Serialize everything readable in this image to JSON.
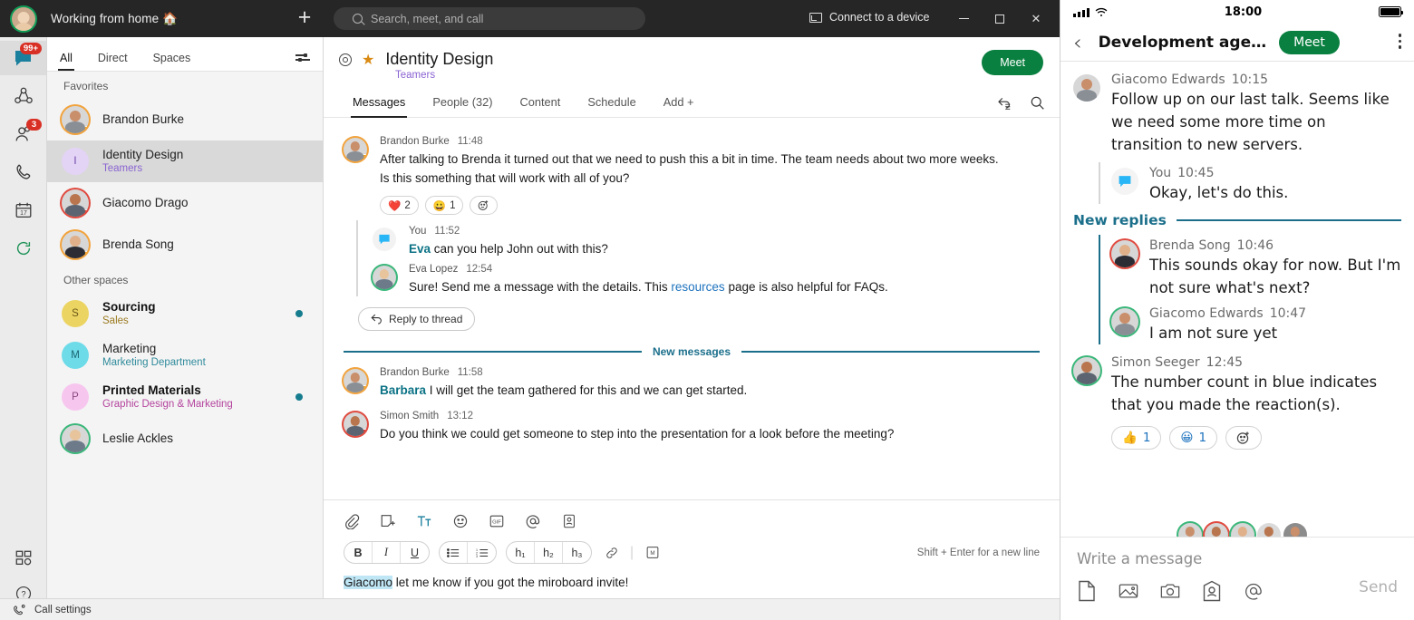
{
  "desktop": {
    "titlebar": {
      "status_text": "Working from home 🏠",
      "plus_icon": "plus-icon",
      "search_placeholder": "Search, meet, and call",
      "connect_label": "Connect to a device",
      "minimize": "−",
      "maximize": "▢",
      "close": "✕"
    },
    "rail": {
      "items": [
        {
          "name": "messages",
          "badge": "99+"
        },
        {
          "name": "spaces",
          "badge": ""
        },
        {
          "name": "contacts",
          "badge": "3"
        },
        {
          "name": "calls",
          "badge": ""
        },
        {
          "name": "calendar",
          "badge": "17"
        },
        {
          "name": "sync",
          "badge": ""
        }
      ],
      "apps_label": "apps-icon",
      "help_label": "Help"
    },
    "list_pane": {
      "tabs": [
        {
          "label": "All",
          "active": true
        },
        {
          "label": "Direct",
          "active": false
        },
        {
          "label": "Spaces",
          "active": false
        }
      ],
      "filter_icon": "filter-icon",
      "sections": [
        {
          "title": "Favorites",
          "rows": [
            {
              "name": "Brandon Burke",
              "sub": "",
              "bold": false,
              "unread": false
            },
            {
              "name": "Identity Design",
              "sub": "Teamers",
              "bold": false,
              "unread": false,
              "selected": true
            },
            {
              "name": "Giacomo Drago",
              "sub": "",
              "bold": false,
              "unread": false
            },
            {
              "name": "Brenda Song",
              "sub": "",
              "bold": false,
              "unread": false
            }
          ]
        },
        {
          "title": "Other spaces",
          "rows": [
            {
              "name": "Sourcing",
              "sub": "Sales",
              "bold": true,
              "unread": true,
              "initial": "S"
            },
            {
              "name": "Marketing",
              "sub": "Marketing Department",
              "bold": false,
              "unread": false,
              "initial": "M"
            },
            {
              "name": "Printed Materials",
              "sub": "Graphic Design & Marketing",
              "bold": true,
              "unread": true,
              "initial": "P"
            },
            {
              "name": "Leslie Ackles",
              "sub": "",
              "bold": false,
              "unread": false
            }
          ]
        }
      ]
    },
    "chat": {
      "gear_icon": "gear-icon",
      "star_icon": "star-icon",
      "title": "Identity Design",
      "subtitle": "Teamers",
      "meet_label": "Meet",
      "tabs": [
        {
          "label": "Messages",
          "active": true
        },
        {
          "label": "People (32)",
          "active": false
        },
        {
          "label": "Content",
          "active": false
        },
        {
          "label": "Schedule",
          "active": false
        },
        {
          "label": "Add  +",
          "active": false
        }
      ],
      "header_icons": [
        "mark-read-icon",
        "search-icon"
      ],
      "messages": [
        {
          "author": "Brandon Burke",
          "time": "11:48",
          "text": "After talking to Brenda it turned out that we need to push this a bit in time. The team needs about two more weeks. Is this something that will work with all of you?",
          "reactions": [
            {
              "emoji": "❤️",
              "count": "2"
            },
            {
              "emoji": "😀",
              "count": "1"
            },
            {
              "emoji": "add",
              "count": ""
            }
          ]
        }
      ],
      "thread": [
        {
          "author": "You",
          "time": "11:52",
          "mention": "Eva",
          "text": " can you help John out with this?"
        },
        {
          "author": "Eva Lopez",
          "time": "12:54",
          "text_pre": "Sure! Send me a message with the details. This ",
          "link": "resources",
          "text_post": " page is also helpful for FAQs."
        }
      ],
      "reply_button": "Reply to thread",
      "new_messages_label": "New messages",
      "messages_after": [
        {
          "author": "Brandon Burke",
          "time": "11:58",
          "mention": "Barbara",
          "text": " I will get the team gathered for this and we can get started."
        },
        {
          "author": "Simon Smith",
          "time": "13:12",
          "text": "Do you think we could get someone to step into the presentation for a look before the meeting?"
        }
      ]
    },
    "composer": {
      "row1_icons": [
        "attach-icon",
        "sticker-icon",
        "format-text-icon",
        "emoji-icon",
        "gif-icon",
        "mention-icon",
        "card-icon"
      ],
      "format_groups": [
        [
          "B",
          "I",
          "U"
        ],
        [
          "bullet-list-icon",
          "number-list-icon"
        ],
        [
          "h₁",
          "h₂",
          "h₃"
        ]
      ],
      "link_icon": "link-icon",
      "markdown_icon": "markdown-icon",
      "hint": "Shift + Enter for a new line",
      "draft_mention": "Giacomo",
      "draft_text": " let me know if you got the miroboard invite!"
    },
    "statusbar": {
      "label": "Call settings",
      "icon": "call-settings-icon"
    }
  },
  "mobile": {
    "status": {
      "time": "18:00",
      "signal_icon": "signal-icon",
      "wifi_icon": "wifi-icon",
      "battery_icon": "battery-icon"
    },
    "header": {
      "back_icon": "back-chevron-icon",
      "title": "Development age…",
      "meet_label": "Meet",
      "more_icon": "kebab-menu-icon"
    },
    "messages": [
      {
        "author": "Giacomo Edwards",
        "time": "10:15",
        "text": "Follow up on our last talk. Seems like we need some more time on transition to new servers."
      }
    ],
    "thread_top": [
      {
        "author": "You",
        "time": "10:45",
        "text": "Okay, let's do this."
      }
    ],
    "new_replies_label": "New replies",
    "new_replies": [
      {
        "author": "Brenda Song",
        "time": "10:46",
        "text": "This sounds okay for now. But I'm not sure what's next?"
      },
      {
        "author": "Giacomo Edwards",
        "time": "10:47",
        "text": "I am not sure yet"
      }
    ],
    "last_message": {
      "author": "Simon Seeger",
      "time": "12:45",
      "text": "The number count in blue indicates that you made the reaction(s).",
      "reactions": [
        {
          "emoji": "👍",
          "count": "1"
        },
        {
          "emoji": "😀",
          "count": "1"
        },
        {
          "emoji": "add",
          "count": ""
        }
      ]
    },
    "composer": {
      "placeholder": "Write a message",
      "tools": [
        "file-icon",
        "image-icon",
        "camera-icon",
        "contact-card-icon",
        "mention-icon"
      ],
      "send_label": "Send"
    }
  },
  "colors": {
    "accent_green": "#0a8040",
    "accent_blue": "#1b6f8b",
    "badge_red": "#d93025",
    "mention": "#0b7285",
    "link": "#1e73be"
  }
}
